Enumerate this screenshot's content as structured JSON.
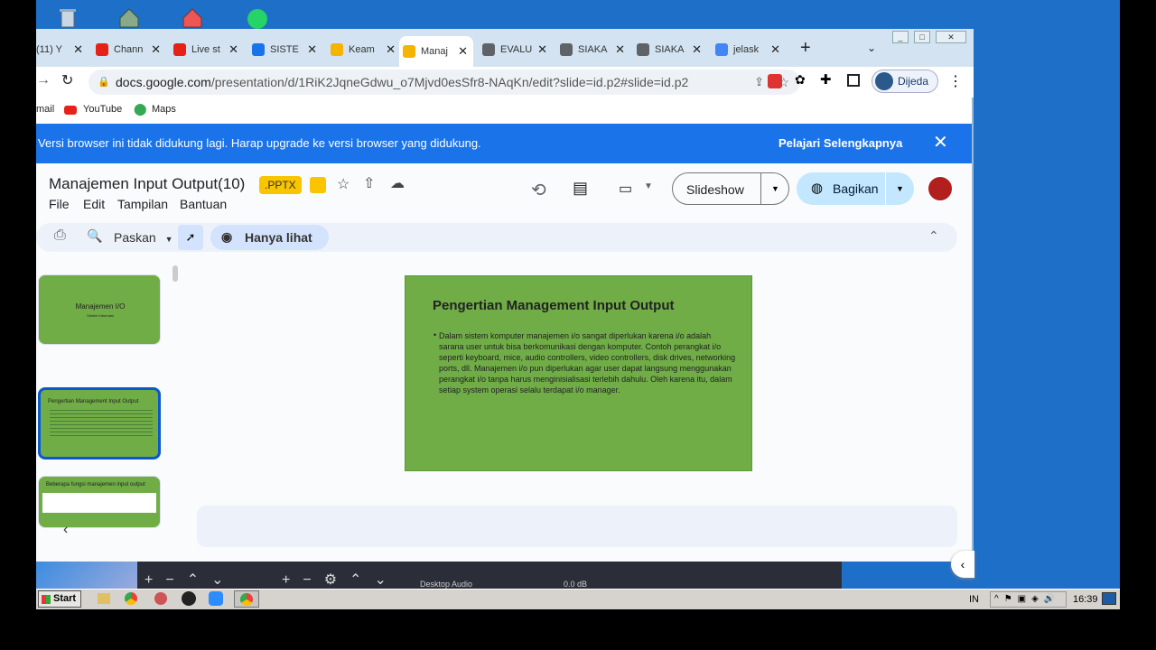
{
  "browser": {
    "tabs": [
      {
        "label": "(11) Y",
        "color": "#888"
      },
      {
        "label": "Chann",
        "color": "#e62117"
      },
      {
        "label": "Live st",
        "color": "#e62117"
      },
      {
        "label": "SISTE",
        "color": "#1a73e8"
      },
      {
        "label": "Keam",
        "color": "#f4b400"
      },
      {
        "label": "Manaj",
        "color": "#f4b400"
      },
      {
        "label": "EVALU",
        "color": "#5f6368"
      },
      {
        "label": "SIAKA",
        "color": "#5f6368"
      },
      {
        "label": "SIAKA",
        "color": "#5f6368"
      },
      {
        "label": "jelask",
        "color": "#4285f4"
      }
    ],
    "new_tab": "+",
    "url_host": "docs.google.com",
    "url_path": "/presentation/d/1RiK2JqneGdwu_o7Mjvd0esSfr8-NAqKn/edit?slide=id.p2#slide=id.p2",
    "profile_label": "Dijeda",
    "bookmarks": [
      "mail",
      "YouTube",
      "Maps"
    ]
  },
  "banner": {
    "message": "Versi browser ini tidak didukung lagi. Harap upgrade ke versi browser yang didukung.",
    "link": "Pelajari Selengkapnya"
  },
  "doc": {
    "title": "Manajemen Input Output(10)",
    "badge": ".PPTX",
    "menus": [
      "File",
      "Edit",
      "Tampilan",
      "Bantuan"
    ],
    "slideshow_label": "Slideshow",
    "share_label": "Bagikan",
    "zoom_label": "Paskan",
    "view_mode_label": "Hanya lihat"
  },
  "thumbnails": [
    {
      "title": "Manajemen I/O",
      "sub": "Sistem Informasi"
    },
    {
      "title": "Pengertian Management Input Output",
      "sub": ""
    },
    {
      "title": "Beberapa fungsi manajemen input output",
      "sub": ""
    }
  ],
  "slide": {
    "title": "Pengertian Management Input Output",
    "bullet": "Dalam sistem komputer manajemen i/o sangat diperlukan karena i/o adalah sarana user untuk bisa berkomunikasi dengan komputer. Contoh perangkat i/o seperti keyboard, mice, audio controllers, video controllers, disk drives, networking ports, dll. Manajemen i/o pun diperlukan agar user dapat langsung menggunakan perangkat i/o tanpa harus menginisialisasi terlebih dahulu. Oleh karena itu, dalam setiap system operasi selalu terdapat i/o manager."
  },
  "obs": {
    "audio_label": "Desktop Audio",
    "db_label": "0.0 dB"
  },
  "taskbar": {
    "start_label": "Start",
    "lang": "IN",
    "clock": "16:39"
  }
}
